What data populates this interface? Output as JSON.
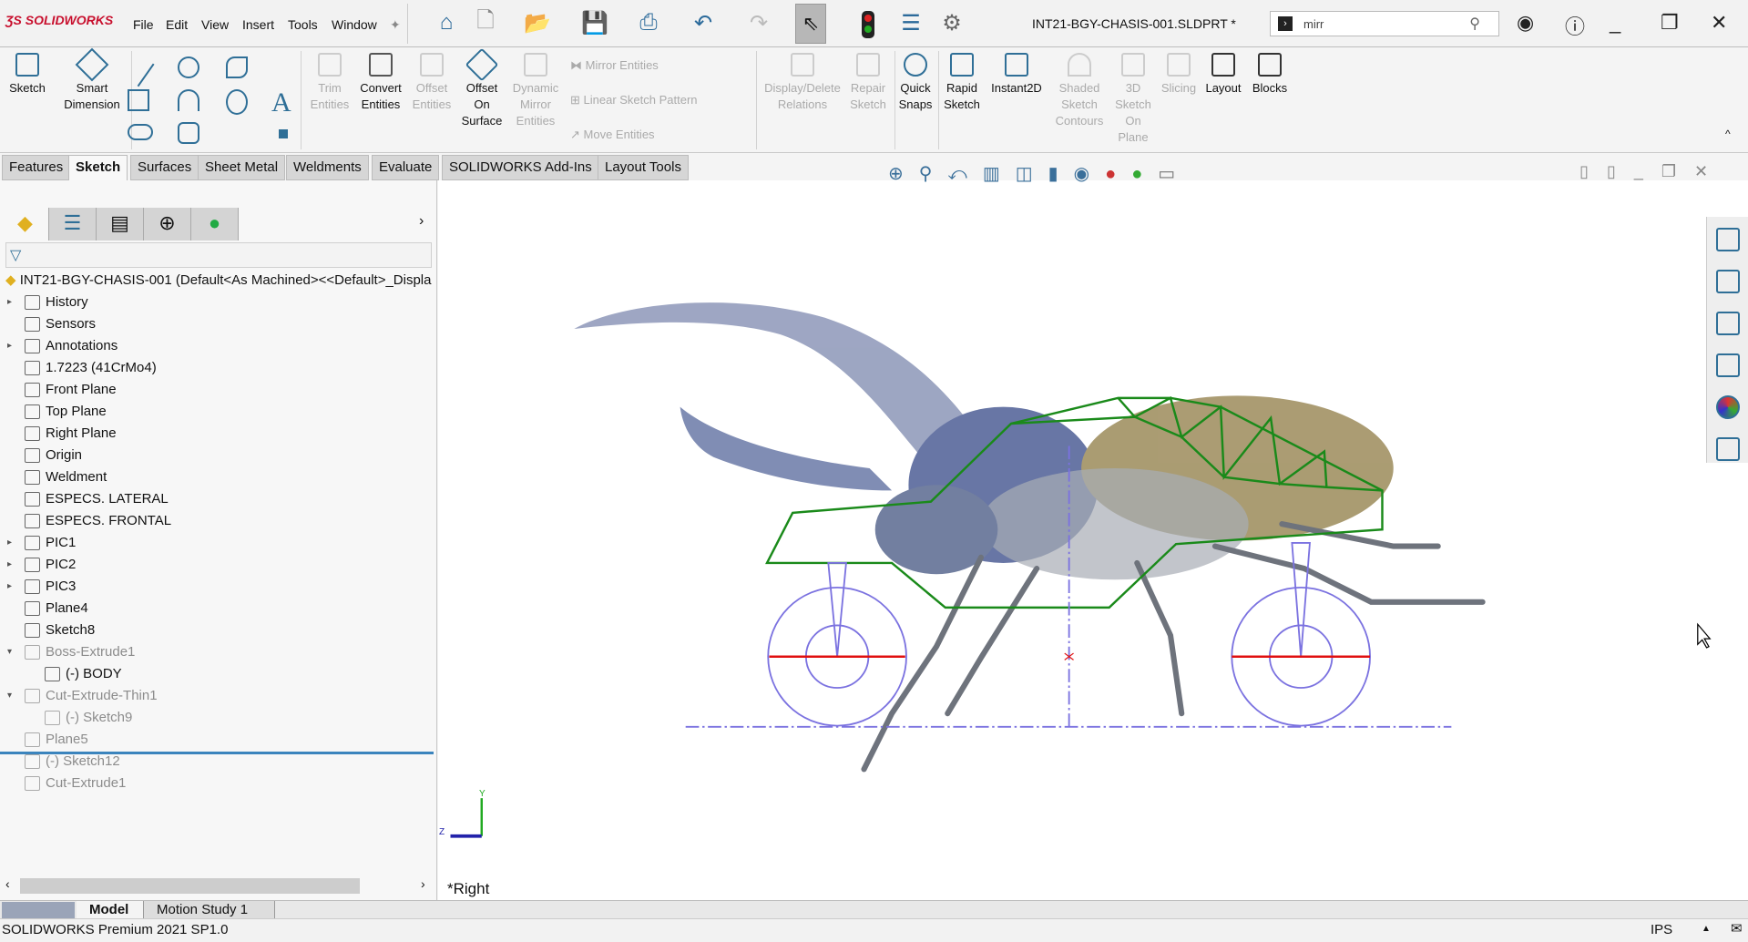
{
  "app": {
    "logo": "SOLIDWORKS",
    "document_title": "INT21-BGY-CHASIS-001.SLDPRT *"
  },
  "menu": [
    "File",
    "Edit",
    "View",
    "Insert",
    "Tools",
    "Window"
  ],
  "search": {
    "value": "mirr"
  },
  "ribbon": {
    "sketch": "Sketch",
    "smart_dimension": "Smart Dimension",
    "trim": "Trim Entities",
    "convert": "Convert Entities",
    "offset": "Offset Entities",
    "offset_surface": "Offset On Surface",
    "dynamic_mirror": "Dynamic Mirror Entities",
    "mirror": "Mirror Entities",
    "linear_pattern": "Linear Sketch Pattern",
    "move": "Move Entities",
    "display_delete": "Display/Delete Relations",
    "repair": "Repair Sketch",
    "quick_snaps": "Quick Snaps",
    "rapid_sketch": "Rapid Sketch",
    "instant2d": "Instant2D",
    "shaded": "Shaded Sketch Contours",
    "sketch3d": "3D Sketch On Plane",
    "slicing": "Slicing",
    "layout": "Layout",
    "blocks": "Blocks"
  },
  "tabs": [
    "Features",
    "Sketch",
    "Surfaces",
    "Sheet Metal",
    "Weldments",
    "Evaluate",
    "SOLIDWORKS Add-Ins",
    "Layout Tools"
  ],
  "active_tab": "Sketch",
  "tree": {
    "root": "INT21-BGY-CHASIS-001  (Default<As Machined><<Default>_Displa",
    "items": [
      {
        "label": "History",
        "expandable": true
      },
      {
        "label": "Sensors"
      },
      {
        "label": "Annotations",
        "expandable": true
      },
      {
        "label": "1.7223 (41CrMo4)"
      },
      {
        "label": "Front Plane"
      },
      {
        "label": "Top Plane"
      },
      {
        "label": "Right Plane"
      },
      {
        "label": "Origin"
      },
      {
        "label": "Weldment"
      },
      {
        "label": "ESPECS. LATERAL"
      },
      {
        "label": "ESPECS. FRONTAL"
      },
      {
        "label": "PIC1",
        "expandable": true
      },
      {
        "label": "PIC2",
        "expandable": true
      },
      {
        "label": "PIC3",
        "expandable": true
      },
      {
        "label": "Plane4"
      },
      {
        "label": "Sketch8"
      },
      {
        "label": "Boss-Extrude1",
        "expanded": true,
        "suppressed": true
      },
      {
        "label": "(-) BODY",
        "indent": 1
      },
      {
        "label": "Cut-Extrude-Thin1",
        "expanded": true,
        "suppressed": true
      },
      {
        "label": "(-) Sketch9",
        "indent": 1,
        "suppressed": true
      },
      {
        "label": "Plane5",
        "suppressed": true
      },
      {
        "label": "(-) Sketch12",
        "suppressed": true
      },
      {
        "label": "Cut-Extrude1",
        "suppressed": true
      }
    ]
  },
  "bottom_tabs": [
    "Model",
    "Motion Study 1"
  ],
  "viewport": {
    "view_name": "*Right",
    "triad": {
      "y": "Y",
      "z": "Z"
    }
  },
  "status": {
    "text": "SOLIDWORKS Premium 2021 SP1.0",
    "units": "IPS"
  },
  "colors": {
    "sketch_green": "#1a8a1a",
    "construction_blue": "#7b72e0",
    "centerline_red": "#e01010",
    "accent": "#3b84bd"
  }
}
